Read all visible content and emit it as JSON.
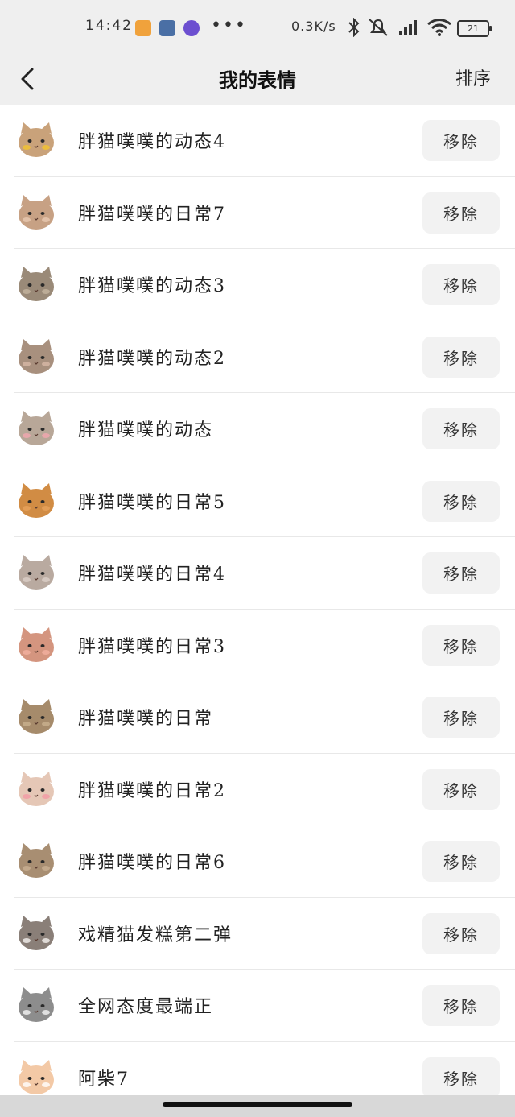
{
  "status_bar": {
    "time": "14:42",
    "ellipsis": "•••",
    "net_speed": "0.3K/s",
    "battery": "21"
  },
  "header": {
    "back_icon": "chevron-left-icon",
    "title": "我的表情",
    "sort_label": "排序"
  },
  "items": [
    {
      "title": "胖猫噗噗的动态4",
      "remove_label": "移除",
      "thumb_color": "#c9a27a",
      "accent": "#f4c430"
    },
    {
      "title": "胖猫噗噗的日常7",
      "remove_label": "移除",
      "thumb_color": "#c7a184",
      "accent": "#e8c9b1"
    },
    {
      "title": "胖猫噗噗的动态3",
      "remove_label": "移除",
      "thumb_color": "#9a8a78",
      "accent": "#c4b49f"
    },
    {
      "title": "胖猫噗噗的动态2",
      "remove_label": "移除",
      "thumb_color": "#a8907e",
      "accent": "#d7b8a6"
    },
    {
      "title": "胖猫噗噗的动态",
      "remove_label": "移除",
      "thumb_color": "#b8a798",
      "accent": "#f2a7b0"
    },
    {
      "title": "胖猫噗噗的日常5",
      "remove_label": "移除",
      "thumb_color": "#d18c44",
      "accent": "#e7a25c"
    },
    {
      "title": "胖猫噗噗的日常4",
      "remove_label": "移除",
      "thumb_color": "#b9aaa0",
      "accent": "#dcd0c8"
    },
    {
      "title": "胖猫噗噗的日常3",
      "remove_label": "移除",
      "thumb_color": "#d4957f",
      "accent": "#f2b0a0"
    },
    {
      "title": "胖猫噗噗的日常",
      "remove_label": "移除",
      "thumb_color": "#a68b6b",
      "accent": "#c9b08f"
    },
    {
      "title": "胖猫噗噗的日常2",
      "remove_label": "移除",
      "thumb_color": "#e5c7b6",
      "accent": "#f29aa5"
    },
    {
      "title": "胖猫噗噗的日常6",
      "remove_label": "移除",
      "thumb_color": "#a88e72",
      "accent": "#c9b092"
    },
    {
      "title": "戏精猫发糕第二弹",
      "remove_label": "移除",
      "thumb_color": "#8a7f78",
      "accent": "#f4f1ee"
    },
    {
      "title": "全网态度最端正",
      "remove_label": "移除",
      "thumb_color": "#8d8d8d",
      "accent": "#f5f5f5"
    },
    {
      "title": "阿柴7",
      "remove_label": "移除",
      "thumb_color": "#f3c9a6",
      "accent": "#ffffff"
    }
  ]
}
